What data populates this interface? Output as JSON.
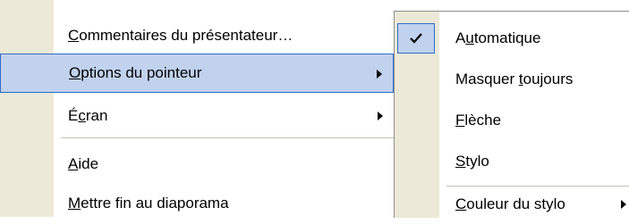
{
  "main_menu": {
    "items": [
      {
        "label": "Commentaires du présentateur…",
        "has_submenu": false,
        "highlighted": false
      },
      {
        "label": "Options du pointeur",
        "has_submenu": true,
        "highlighted": true
      },
      {
        "label": "Écran",
        "has_submenu": true,
        "highlighted": false
      },
      {
        "label": "Aide",
        "has_submenu": false,
        "highlighted": false
      },
      {
        "label": "Mettre fin au diaporama",
        "has_submenu": false,
        "highlighted": false
      }
    ]
  },
  "submenu": {
    "items": [
      {
        "label": "Automatique",
        "checked": true
      },
      {
        "label": "Masquer toujours",
        "checked": false
      },
      {
        "label": "Flèche",
        "checked": false
      },
      {
        "label": "Stylo",
        "checked": false
      },
      {
        "label": "Couleur du stylo",
        "checked": false,
        "has_submenu": true
      }
    ]
  },
  "colors": {
    "highlight_fill": "#c1d2ee",
    "highlight_border": "#316ac5",
    "gutter": "#ece9d8"
  }
}
